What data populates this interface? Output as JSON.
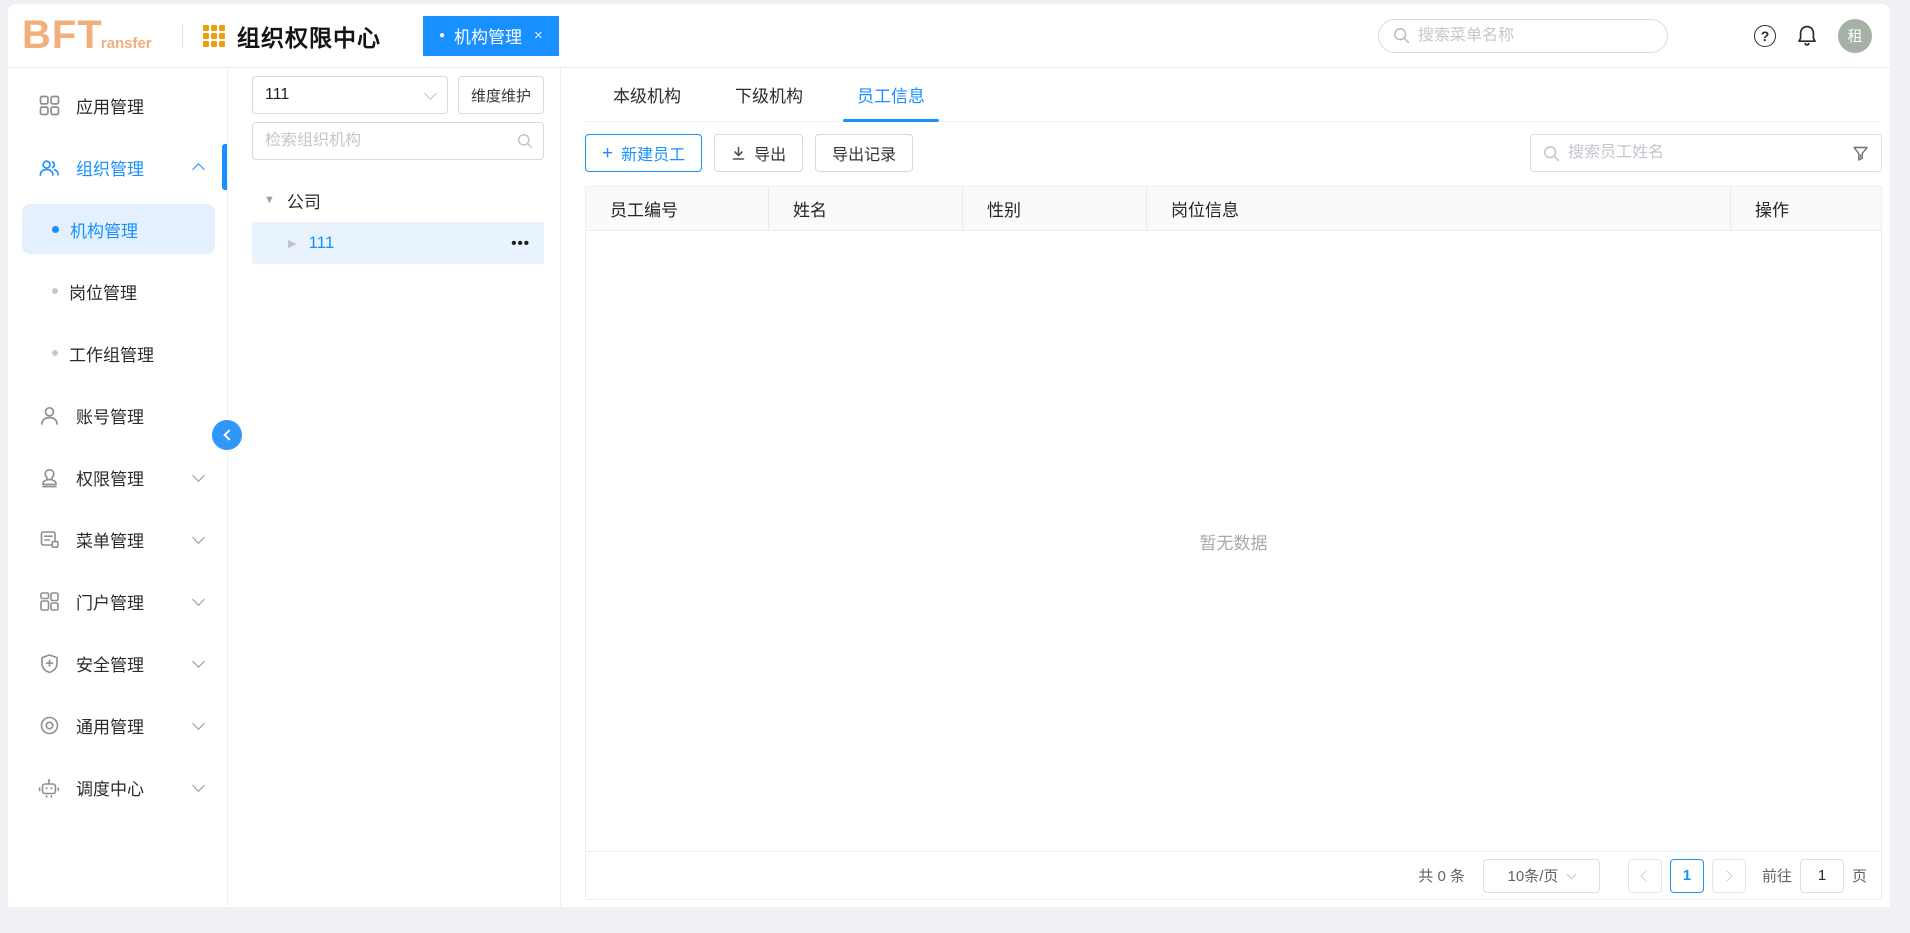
{
  "header": {
    "logo": {
      "main": "BFT",
      "sub": "ransfer"
    },
    "app_title": "组织权限中心",
    "window_tab": {
      "dot": "●",
      "label": "机构管理",
      "close": "×"
    },
    "menu_search_placeholder": "搜索菜单名称",
    "help_glyph": "?",
    "avatar_text": "租"
  },
  "sidebar": {
    "items": [
      {
        "label": "应用管理",
        "icon": "apps-grid-icon"
      },
      {
        "label": "组织管理",
        "icon": "people-icon"
      },
      {
        "label": "机构管理"
      },
      {
        "label": "岗位管理"
      },
      {
        "label": "工作组管理"
      },
      {
        "label": "账号管理",
        "icon": "person-icon"
      },
      {
        "label": "权限管理",
        "icon": "stamp-icon"
      },
      {
        "label": "菜单管理",
        "icon": "menu-doc-icon"
      },
      {
        "label": "门户管理",
        "icon": "portal-grid-icon"
      },
      {
        "label": "安全管理",
        "icon": "shield-plus-icon"
      },
      {
        "label": "通用管理",
        "icon": "settings-icon"
      },
      {
        "label": "调度中心",
        "icon": "robot-icon"
      }
    ]
  },
  "org_panel": {
    "dimension_value": "111",
    "maintain_button": "维度维护",
    "search_placeholder": "检索组织机构",
    "tree_root": "公司",
    "tree_child": "111"
  },
  "main": {
    "tabs": [
      "本级机构",
      "下级机构",
      "员工信息"
    ],
    "toolbar": {
      "new_employee": "新建员工",
      "export": "导出",
      "export_records": "导出记录",
      "search_placeholder": "搜索员工姓名"
    },
    "table": {
      "cols": [
        "员工编号",
        "姓名",
        "性别",
        "岗位信息",
        "操作"
      ],
      "empty": "暂无数据"
    },
    "pagination": {
      "total": "共 0 条",
      "page_size": "10条/页",
      "page": "1",
      "goto_label": "前往",
      "goto_value": "1",
      "unit": "页"
    }
  },
  "icons": {
    "plus": "+",
    "more": "•••",
    "caret_down": "▼",
    "caret_right": "▶"
  },
  "colors": {
    "primary": "#1890ff",
    "logo_orange": "#f3ae7d",
    "brand_grid_orange": "#e9a112",
    "avatar_bg": "#a4b2a6",
    "active_pill_bg": "#e4f0fd",
    "table_header_bg": "#fafafa"
  }
}
